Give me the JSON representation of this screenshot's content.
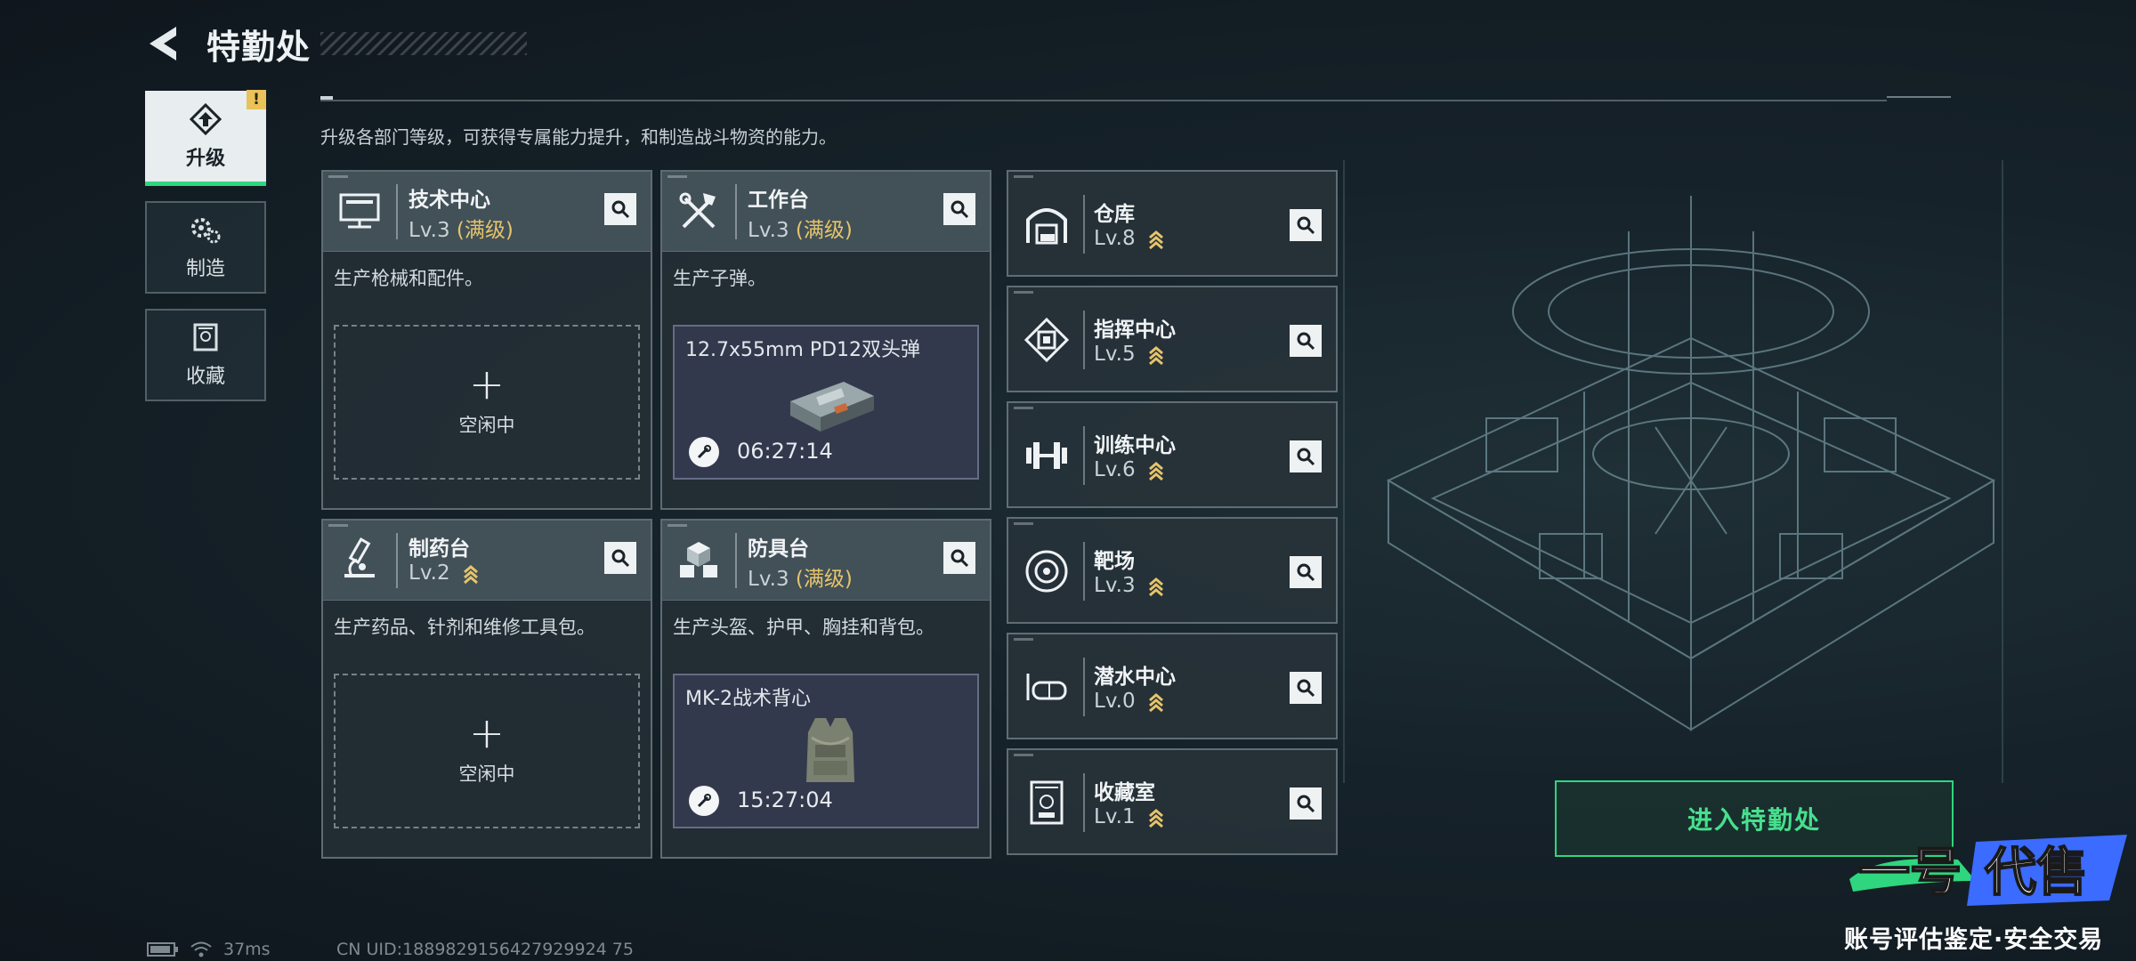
{
  "header": {
    "title": "特勤处"
  },
  "intro": "升级各部门等级，可获得专属能力提升，和制造战斗物资的能力。",
  "tabs": [
    {
      "label": "升级",
      "icon": "upgrade-icon",
      "active": true,
      "warning": "!"
    },
    {
      "label": "制造",
      "icon": "gears-icon",
      "active": false
    },
    {
      "label": "收藏",
      "icon": "collection-icon",
      "active": false
    }
  ],
  "cards": [
    {
      "name": "技术中心",
      "level": "Lv.3",
      "max_label": "(满级)",
      "desc": "生产枪械和配件。",
      "status": "idle",
      "idle_plus": "+",
      "idle_label": "空闲中",
      "icon": "computer-icon"
    },
    {
      "name": "工作台",
      "level": "Lv.3",
      "max_label": "(满级)",
      "desc": "生产子弹。",
      "status": "crafting",
      "item": "12.7x55mm PD12双头弹",
      "time": "06:27:14",
      "icon": "tools-icon"
    },
    {
      "name": "制药台",
      "level": "Lv.2",
      "desc": "生产药品、针剂和维修工具包。",
      "status": "idle",
      "idle_plus": "+",
      "idle_label": "空闲中",
      "icon": "microscope-icon"
    },
    {
      "name": "防具台",
      "level": "Lv.3",
      "max_label": "(满级)",
      "desc": "生产头盔、护甲、胸挂和背包。",
      "status": "crafting",
      "item": "MK-2战术背心",
      "time": "15:27:04",
      "icon": "armor-blocks-icon"
    }
  ],
  "rooms": [
    {
      "name": "仓库",
      "level": "Lv.8",
      "icon": "warehouse-icon"
    },
    {
      "name": "指挥中心",
      "level": "Lv.5",
      "icon": "command-chip-icon"
    },
    {
      "name": "训练中心",
      "level": "Lv.6",
      "icon": "dumbbell-icon"
    },
    {
      "name": "靶场",
      "level": "Lv.3",
      "icon": "target-icon"
    },
    {
      "name": "潜水中心",
      "level": "Lv.0",
      "icon": "dive-mask-icon"
    },
    {
      "name": "收藏室",
      "level": "Lv.1",
      "icon": "display-case-icon"
    }
  ],
  "enter_button": "进入特勤处",
  "footer": {
    "ping": "37ms",
    "uid": "CN UID:1889829156427929924 75"
  },
  "watermark": {
    "logo": "一号代售",
    "tagline": "账号评估鉴定·安全交易"
  },
  "colors": {
    "accent": "#2fd67f",
    "max_level": "#e5c46b",
    "warning": "#e9c25a"
  }
}
